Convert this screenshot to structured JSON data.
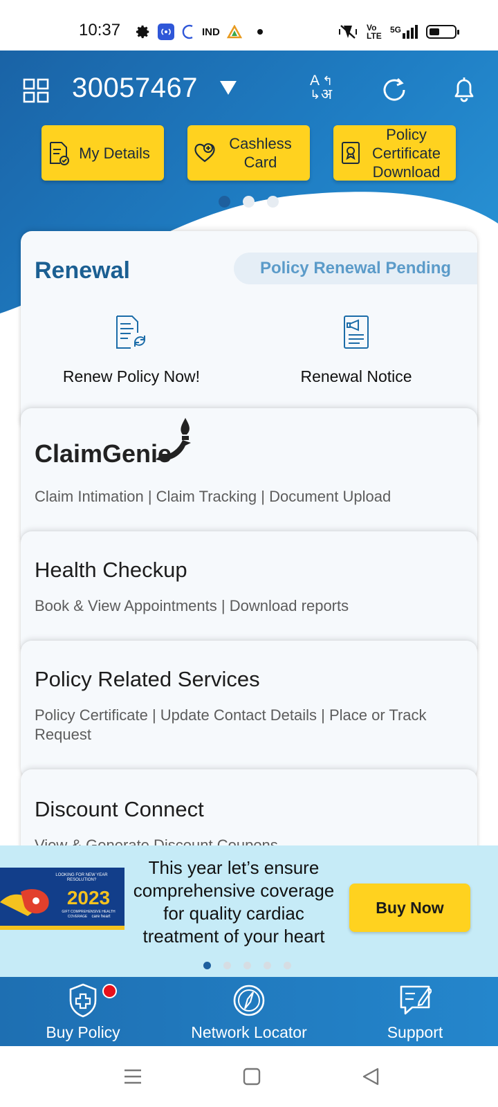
{
  "status_bar": {
    "time": "10:37",
    "left_icons": [
      "gear-icon",
      "broadcast-icon",
      "c-icon",
      "ind-icon",
      "triangle-icon",
      "dot-icon"
    ],
    "right_icons": [
      "vibrate-icon",
      "volte-icon",
      "5g-signal-icon",
      "battery-icon"
    ],
    "ind_text": "IND",
    "volte_text": "Vo LTE",
    "signal_text": "5G"
  },
  "header": {
    "policy_number": "30057467",
    "lang_glyph_top": "A",
    "lang_glyph_bottom": "अ",
    "quick_actions": [
      {
        "label": "My Details",
        "icon": "document-check-icon"
      },
      {
        "label": "Cashless Card",
        "icon": "heart-plus-icon"
      },
      {
        "label": "Policy Certificate Download",
        "icon": "certificate-icon"
      }
    ],
    "carousel_pages": 3,
    "carousel_active": 0
  },
  "renewal": {
    "title": "Renewal",
    "badge": "Policy Renewal Pending",
    "actions": [
      {
        "label": "Renew Policy Now!",
        "icon": "renew-document-icon"
      },
      {
        "label": "Renewal Notice",
        "icon": "notice-document-icon"
      }
    ]
  },
  "claim": {
    "logo_text": "ClaimGenie",
    "subtitle": "Claim Intimation | Claim Tracking | Document Upload"
  },
  "health": {
    "title": "Health Checkup",
    "subtitle": "Book & View Appointments | Download reports"
  },
  "policy_services": {
    "title": "Policy Related Services",
    "subtitle": "Policy Certificate | Update Contact Details | Place or Track Request"
  },
  "discount": {
    "title": "Discount Connect",
    "subtitle": "View & Generate Discount Coupons"
  },
  "promo": {
    "image_line1": "LOOKING FOR NEW YEAR",
    "image_line2": "RESOLUTION?",
    "image_year": "2023",
    "image_line3": "GIFT COMPREHENSIVE HEALTH",
    "image_line4": "COVERAGE",
    "image_brand": "care heart",
    "text": "This year let’s ensure comprehensive coverage for quality cardiac treatment of your heart",
    "button": "Buy Now",
    "pages": 5,
    "active": 0
  },
  "bottom_nav": [
    {
      "label": "Buy Policy",
      "icon": "shield-plus-icon",
      "notification": true
    },
    {
      "label": "Network Locator",
      "icon": "compass-icon",
      "notification": false
    },
    {
      "label": "Support",
      "icon": "chat-edit-icon",
      "notification": false
    }
  ],
  "colors": {
    "header_blue": "#1f7ec4",
    "accent_yellow": "#ffd21f",
    "title_blue": "#1b5f92",
    "promo_bg": "#c6ebf7",
    "notification_red": "#e8101b"
  }
}
